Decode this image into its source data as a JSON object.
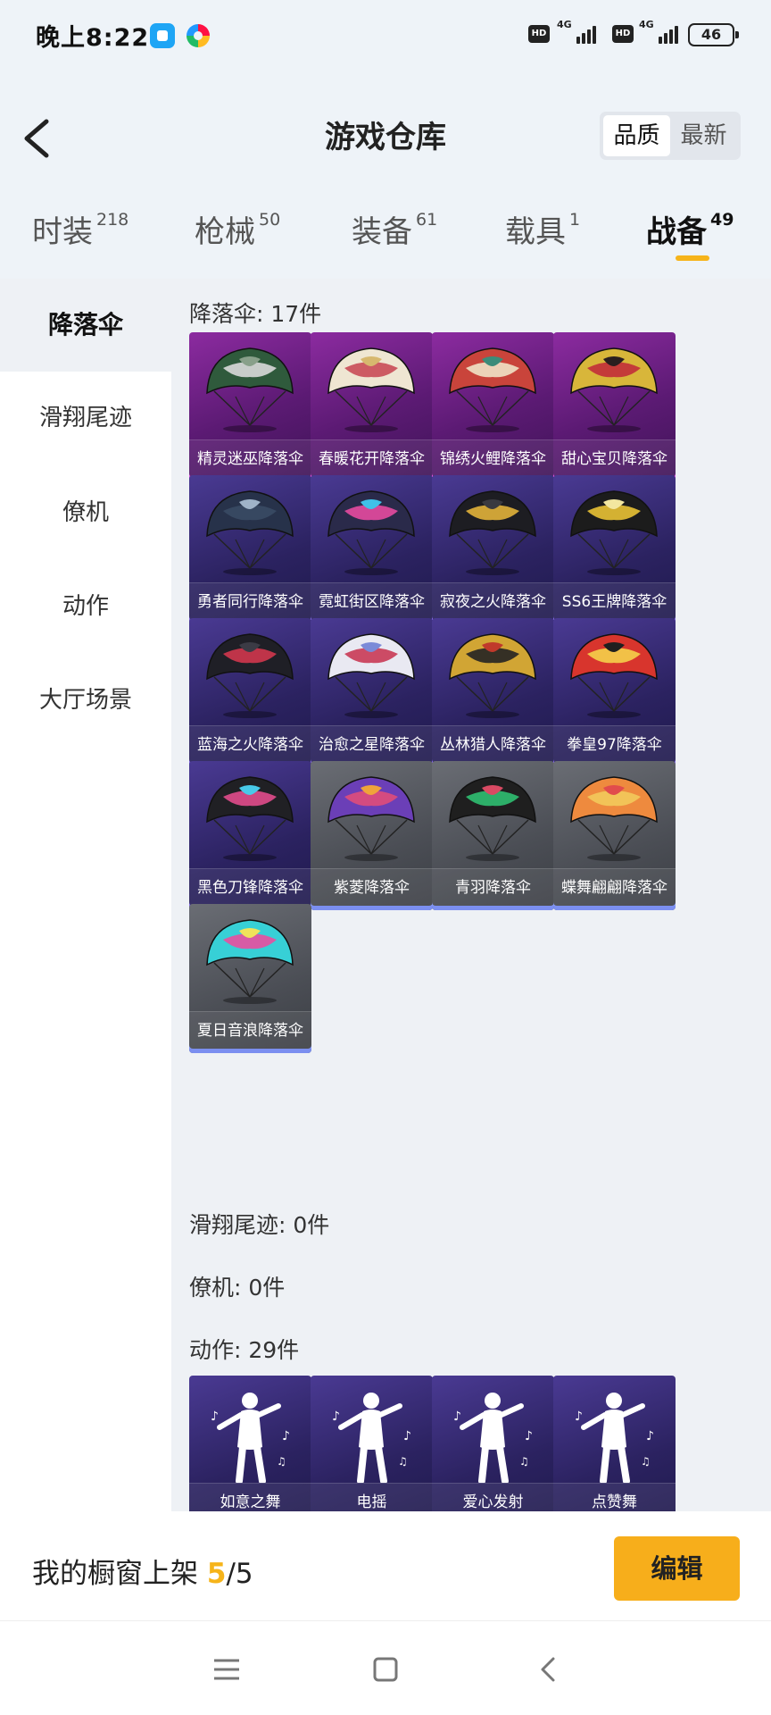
{
  "status_bar": {
    "time": "晚上8:22",
    "hd": "HD",
    "network": "4G",
    "battery": "46"
  },
  "header": {
    "title": "游戏仓库",
    "sort_options": [
      "品质",
      "最新"
    ],
    "sort_active": "品质"
  },
  "tabs": [
    {
      "label": "时装",
      "count": "218"
    },
    {
      "label": "枪械",
      "count": "50"
    },
    {
      "label": "装备",
      "count": "61"
    },
    {
      "label": "载具",
      "count": "1"
    },
    {
      "label": "战备",
      "count": "49"
    }
  ],
  "active_tab": "战备",
  "sidebar": {
    "items": [
      "降落伞",
      "滑翔尾迹",
      "僚机",
      "动作",
      "大厅场景"
    ],
    "active": "降落伞"
  },
  "sections": {
    "parachute": {
      "title": "降落伞: 17件",
      "items": [
        {
          "name": "精灵迷巫降落伞",
          "rarity": "purple",
          "colors": [
            "#2f5a3c",
            "#d9d9d9",
            "#88a08a"
          ]
        },
        {
          "name": "春暖花开降落伞",
          "rarity": "purple",
          "colors": [
            "#efe6d2",
            "#c94b57",
            "#d7b86e"
          ]
        },
        {
          "name": "锦绣火鲤降落伞",
          "rarity": "purple",
          "colors": [
            "#c9443b",
            "#f0e3c6",
            "#3c8c79"
          ]
        },
        {
          "name": "甜心宝贝降落伞",
          "rarity": "purple",
          "colors": [
            "#d8b63a",
            "#c22e3a",
            "#2a1f1f"
          ]
        },
        {
          "name": "勇者同行降落伞",
          "rarity": "violet",
          "colors": [
            "#27324a",
            "#3a4a64",
            "#9fb3c8"
          ]
        },
        {
          "name": "霓虹街区降落伞",
          "rarity": "violet",
          "colors": [
            "#2a2a4a",
            "#e64aa0",
            "#3fc1e8"
          ]
        },
        {
          "name": "寂夜之火降落伞",
          "rarity": "violet",
          "colors": [
            "#1d1d22",
            "#e2b23a",
            "#3a3a40"
          ]
        },
        {
          "name": "SS6王牌降落伞",
          "rarity": "violet",
          "colors": [
            "#1c1c1c",
            "#e9c235",
            "#f3e7a0"
          ]
        },
        {
          "name": "蓝海之火降落伞",
          "rarity": "violet",
          "colors": [
            "#1f1f26",
            "#d0364e",
            "#3b3b45"
          ]
        },
        {
          "name": "治愈之星降落伞",
          "rarity": "violet",
          "colors": [
            "#e9e9f2",
            "#c93a55",
            "#7b8ad8"
          ]
        },
        {
          "name": "丛林猎人降落伞",
          "rarity": "violet",
          "colors": [
            "#d1a534",
            "#232323",
            "#c0392b"
          ]
        },
        {
          "name": "拳皇97降落伞",
          "rarity": "violet",
          "colors": [
            "#d8352d",
            "#f5d04a",
            "#1f1f1f"
          ]
        },
        {
          "name": "黑色刀锋降落伞",
          "rarity": "violet",
          "colors": [
            "#202024",
            "#e14b8c",
            "#48c9e8"
          ]
        },
        {
          "name": "紫菱降落伞",
          "rarity": "gray",
          "colors": [
            "#6b3fb7",
            "#e04d7a",
            "#f0a43a"
          ]
        },
        {
          "name": "青羽降落伞",
          "rarity": "gray",
          "colors": [
            "#1f1f1f",
            "#2fbf71",
            "#d94a63"
          ]
        },
        {
          "name": "蝶舞翩翩降落伞",
          "rarity": "gray",
          "colors": [
            "#ee8a3e",
            "#f2c95b",
            "#e14c4c"
          ]
        },
        {
          "name": "夏日音浪降落伞",
          "rarity": "gray",
          "colors": [
            "#37d0d6",
            "#e94ea0",
            "#f0e35a"
          ]
        }
      ]
    },
    "glide_trail": {
      "title": "滑翔尾迹: 0件"
    },
    "wingman": {
      "title": "僚机: 0件"
    },
    "emote": {
      "title": "动作: 29件",
      "items": [
        {
          "name": "如意之舞",
          "rarity": "violet"
        },
        {
          "name": "电摇",
          "rarity": "violet"
        },
        {
          "name": "爱心发射",
          "rarity": "violet"
        },
        {
          "name": "点赞舞",
          "rarity": "violet"
        }
      ]
    }
  },
  "showcase": {
    "label": "我的橱窗上架",
    "used": "5",
    "total": "/5",
    "edit_label": "编辑"
  },
  "accent_color": "#f6b41a"
}
